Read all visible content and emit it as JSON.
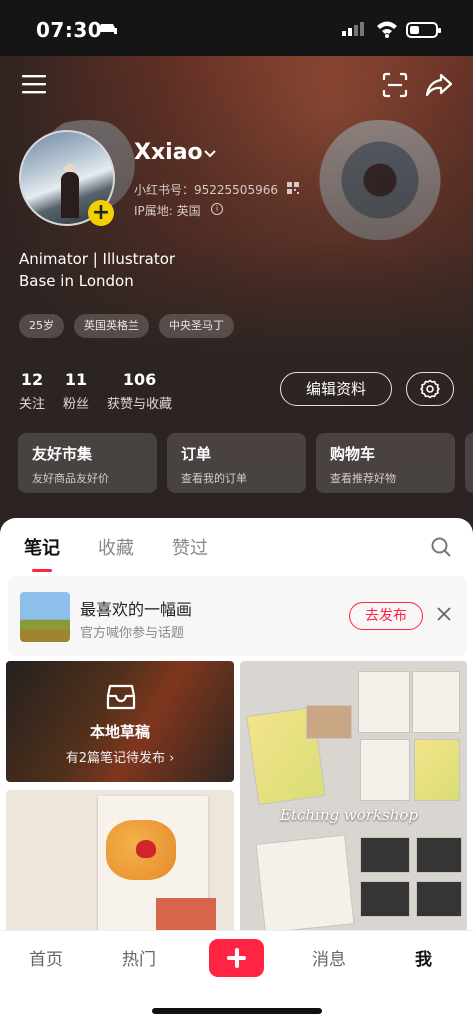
{
  "status": {
    "time": "07:30"
  },
  "profile": {
    "name": "Xxiao",
    "uid": "小红书号：95225505966",
    "ip": "IP属地: 英国",
    "bio_line1": "Animator | Illustrator",
    "bio_line2": "Base in London",
    "tags": [
      "25岁",
      "英国英格兰",
      "中央圣马丁"
    ]
  },
  "stats": [
    {
      "num": "12",
      "label": "关注"
    },
    {
      "num": "11",
      "label": "粉丝"
    },
    {
      "num": "106",
      "label": "获赞与收藏"
    }
  ],
  "actions": {
    "edit": "编辑资料"
  },
  "cards": [
    {
      "title": "友好市集",
      "sub": "友好商品友好价"
    },
    {
      "title": "订单",
      "sub": "查看我的订单"
    },
    {
      "title": "购物车",
      "sub": "查看推荐好物"
    }
  ],
  "tabs": [
    "笔记",
    "收藏",
    "赞过"
  ],
  "topic": {
    "title": "最喜欢的一幅画",
    "sub": "官方喊你参与话题",
    "button": "去发布"
  },
  "draft": {
    "title": "本地草稿",
    "sub": "有2篇笔记待发布 ›"
  },
  "post_caption": "Etching workshop",
  "nav": [
    "首页",
    "热门",
    "消息",
    "我"
  ],
  "colors": {
    "accent": "#ff2442",
    "badge": "#f4d000"
  }
}
